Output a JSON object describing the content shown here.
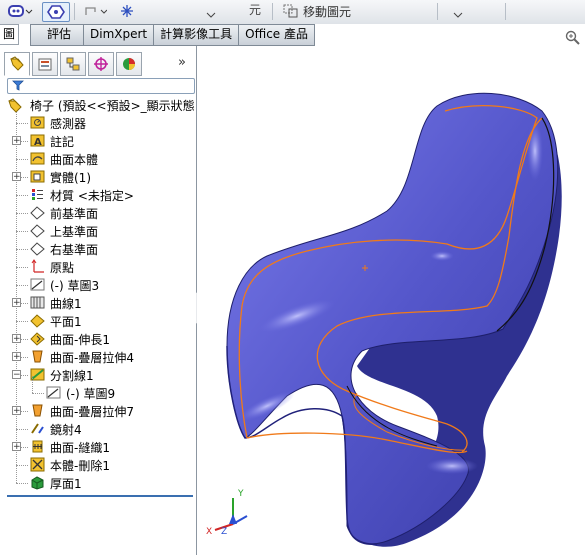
{
  "toolbar": {
    "move_label": "移動圖元",
    "partial_label": "元"
  },
  "commandmanager": {
    "left_tab": "圖",
    "tabs": [
      "評估",
      "DimXpert",
      "計算影像工具",
      "Office 產品"
    ]
  },
  "feature_tree": {
    "root": "椅子  (預設<<預設>_顯示狀態",
    "items": [
      {
        "label": "感測器"
      },
      {
        "label": "註記"
      },
      {
        "label": "曲面本體"
      },
      {
        "label": "實體(1)"
      },
      {
        "label": "材質 <未指定>"
      },
      {
        "label": "前基準面"
      },
      {
        "label": "上基準面"
      },
      {
        "label": "右基準面"
      },
      {
        "label": "原點"
      },
      {
        "label": "(-) 草圖3"
      },
      {
        "label": "曲線1"
      },
      {
        "label": "平面1"
      },
      {
        "label": "曲面-伸長1"
      },
      {
        "label": "曲面-疊層拉伸4"
      },
      {
        "label": "分割線1"
      },
      {
        "label": "(-) 草圖9"
      },
      {
        "label": "曲面-疊層拉伸7"
      },
      {
        "label": "鏡射4"
      },
      {
        "label": "曲面-縫織1"
      },
      {
        "label": "本體-刪除1"
      },
      {
        "label": "厚面1"
      }
    ]
  },
  "triad": {
    "x": "X",
    "y": "Y",
    "z": "Z"
  },
  "colors": {
    "chair_body": "#5a5ccf",
    "split_line": "#f07a1a",
    "tab_border": "#7f8a96"
  }
}
